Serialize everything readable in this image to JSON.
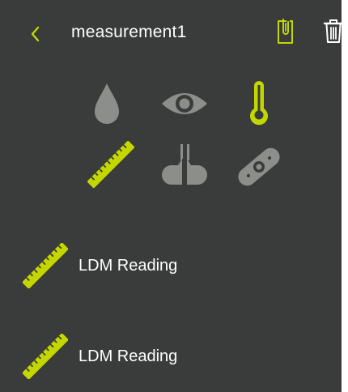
{
  "header": {
    "title": "measurement1",
    "back_icon": "chevron-left-icon",
    "attach_icon": "paperclip-document-icon",
    "delete_icon": "trash-icon"
  },
  "tool_grid": [
    {
      "name": "droplet-icon",
      "active": false
    },
    {
      "name": "eye-icon",
      "active": false
    },
    {
      "name": "thermometer-icon",
      "active": true
    },
    {
      "name": "ruler-icon",
      "active": true
    },
    {
      "name": "cable-connector-icon",
      "active": false
    },
    {
      "name": "bandage-icon",
      "active": false
    }
  ],
  "readings": [
    {
      "label": "LDM Reading",
      "icon": "ruler-icon"
    },
    {
      "label": "LDM Reading",
      "icon": "ruler-icon"
    }
  ],
  "colors": {
    "background": "#393c3a",
    "accent": "#c4d600",
    "inactive": "#8c8e8c",
    "text": "#ffffff"
  }
}
